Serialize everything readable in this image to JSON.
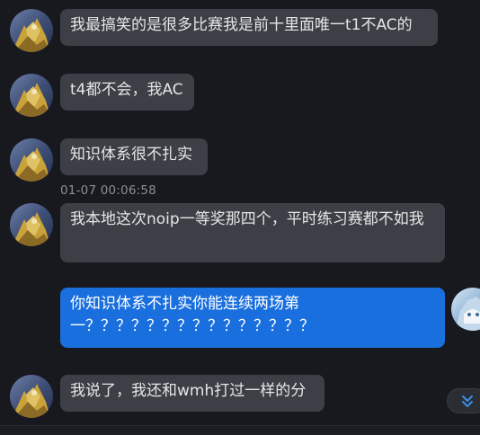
{
  "messages": [
    {
      "sender": "other",
      "text": "我最搞笑的是很多比赛我是前十里面唯一t1不AC的"
    },
    {
      "sender": "other",
      "text": "t4都不会，我AC"
    },
    {
      "sender": "other",
      "text": "知识体系很不扎实"
    },
    {
      "sender": "other",
      "text": "我本地这次noip一等奖那四个，平时练习赛都不如我"
    },
    {
      "sender": "self",
      "text": "你知识体系不扎实你能连续两场第一？？？？？？？？？？？？？？？"
    },
    {
      "sender": "other",
      "text": "我说了，我还和wmh打过一样的分"
    }
  ],
  "timestamp": "01-07 00:06:58",
  "icons": {
    "scroll_down": "double-chevron-down-icon"
  },
  "colors": {
    "background": "#17191e",
    "incoming_bubble": "#3c3f45",
    "outgoing_bubble": "#1a6fde",
    "timestamp": "#8b8f97",
    "scroll_icon": "#3a8ee6"
  }
}
